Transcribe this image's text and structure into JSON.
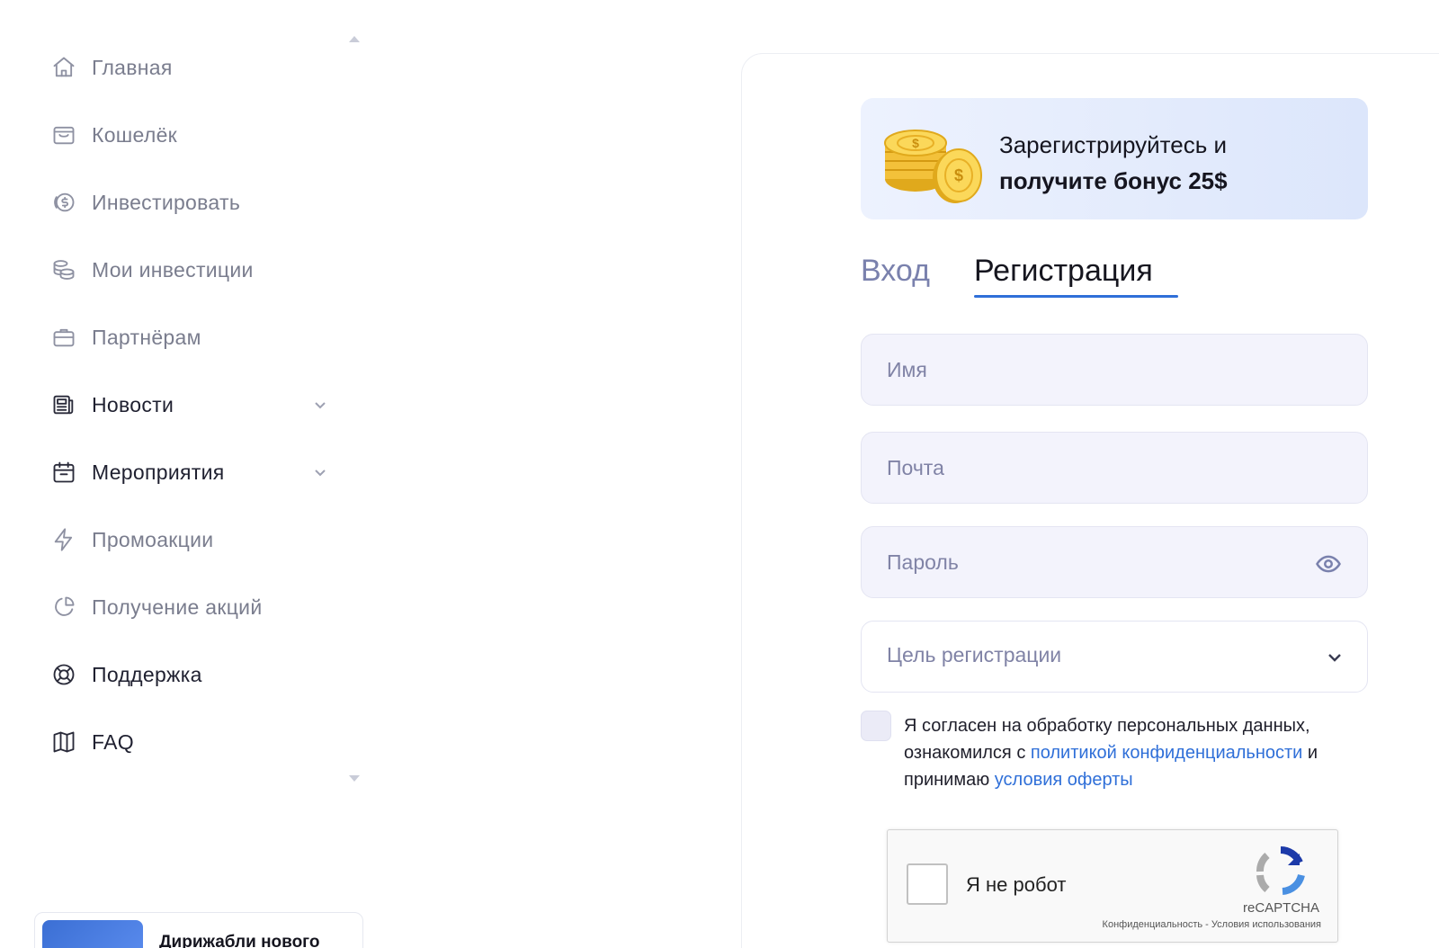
{
  "sidebar": {
    "items": [
      {
        "label": "Главная",
        "icon": "home-icon"
      },
      {
        "label": "Кошелёк",
        "icon": "wallet-icon"
      },
      {
        "label": "Инвестировать",
        "icon": "dollar-coin-icon"
      },
      {
        "label": "Мои инвестиции",
        "icon": "coins-stack-icon"
      },
      {
        "label": "Партнёрам",
        "icon": "briefcase-icon"
      },
      {
        "label": "Новости",
        "icon": "newspaper-icon"
      },
      {
        "label": "Мероприятия",
        "icon": "calendar-icon"
      },
      {
        "label": "Промоакции",
        "icon": "lightning-icon"
      },
      {
        "label": "Получение акций",
        "icon": "pie-chart-icon"
      },
      {
        "label": "Поддержка",
        "icon": "lifebuoy-icon"
      },
      {
        "label": "FAQ",
        "icon": "book-icon"
      }
    ],
    "promo_card": {
      "title": "Дирижабли нового"
    }
  },
  "banner": {
    "line1": "Зарегистрируйтесь и",
    "line2": "получите бонус 25$"
  },
  "tabs": {
    "login": "Вход",
    "register": "Регистрация",
    "active": "register"
  },
  "form": {
    "name_placeholder": "Имя",
    "email_placeholder": "Почта",
    "password_placeholder": "Пароль",
    "goal_placeholder": "Цель регистрации",
    "agree_part1": "Я согласен на обработку персональных данных, ознакомился с ",
    "agree_link1": "политикой конфиденциальности",
    "agree_part2": " и принимаю ",
    "agree_link2": "условия оферты"
  },
  "captcha": {
    "label": "Я не робот",
    "brand": "reCAPTCHA",
    "terms": "Конфиденциальность - Условия использования"
  },
  "colors": {
    "accent": "#2f6fd8",
    "muted_text": "#7a7d8e",
    "input_bg": "#f3f3fc"
  }
}
